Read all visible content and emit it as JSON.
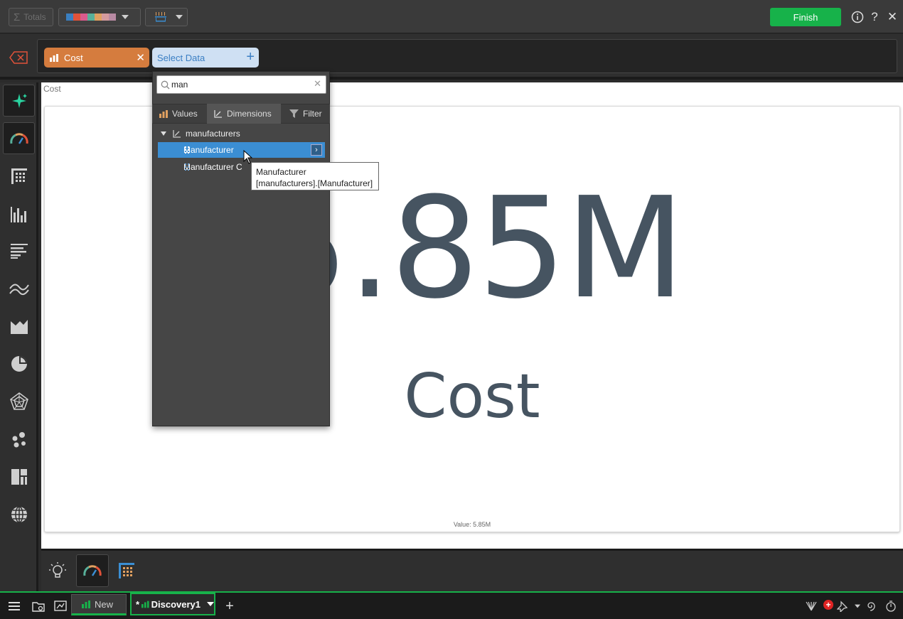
{
  "toolbar": {
    "totals_label": "Totals",
    "palette_colors": [
      "#3a7fc0",
      "#e0523a",
      "#d95b8d",
      "#58b09a",
      "#e0a060",
      "#d49a9e",
      "#b88aa3"
    ],
    "finish_label": "Finish",
    "info_icon": "info-icon",
    "help_label": "?",
    "close_label": "✕"
  },
  "data_row": {
    "value_chip_label": "Cost",
    "select_data_label": "Select Data"
  },
  "dropdown": {
    "search_value": "man",
    "tabs": [
      {
        "label": "Values",
        "icon": "bar-chart-icon"
      },
      {
        "label": "Dimensions",
        "icon": "dimension-icon"
      },
      {
        "label": "Filter",
        "icon": "filter-icon"
      }
    ],
    "tree_root": "manufacturers",
    "items": [
      {
        "label": "Manufacturer",
        "selected": true
      },
      {
        "label": "Manufacturer C"
      }
    ],
    "tooltip_line1": "Manufacturer",
    "tooltip_line2": "[manufacturers].[Manufacturer]"
  },
  "canvas": {
    "title": "Cost",
    "kpi_value": "5.85M",
    "kpi_label": "Cost",
    "footer": "Value: 5.85M"
  },
  "sidebar_icons": [
    "sparkle-icon",
    "gauge-icon",
    "table-icon",
    "column-chart-icon",
    "bar-chart-icon",
    "line-chart-icon",
    "area-chart-icon",
    "pie-chart-icon",
    "radar-icon",
    "scatter-icon",
    "treemap-icon",
    "globe-icon"
  ],
  "bottom_bar": {
    "icons": [
      "lightbulb-icon",
      "gauge-icon",
      "table-icon"
    ]
  },
  "taskbar": {
    "tabs": [
      {
        "label": "New"
      },
      {
        "label": "Discovery1",
        "prefix": "*"
      }
    ],
    "add_label": "+",
    "notification_count": "+"
  },
  "colors": {
    "accent_green": "#17b24a",
    "value_chip": "#d57c3e",
    "select_chip": "#cfe0f3",
    "selection_blue": "#3b8ed3",
    "kpi_text": "#465461"
  }
}
